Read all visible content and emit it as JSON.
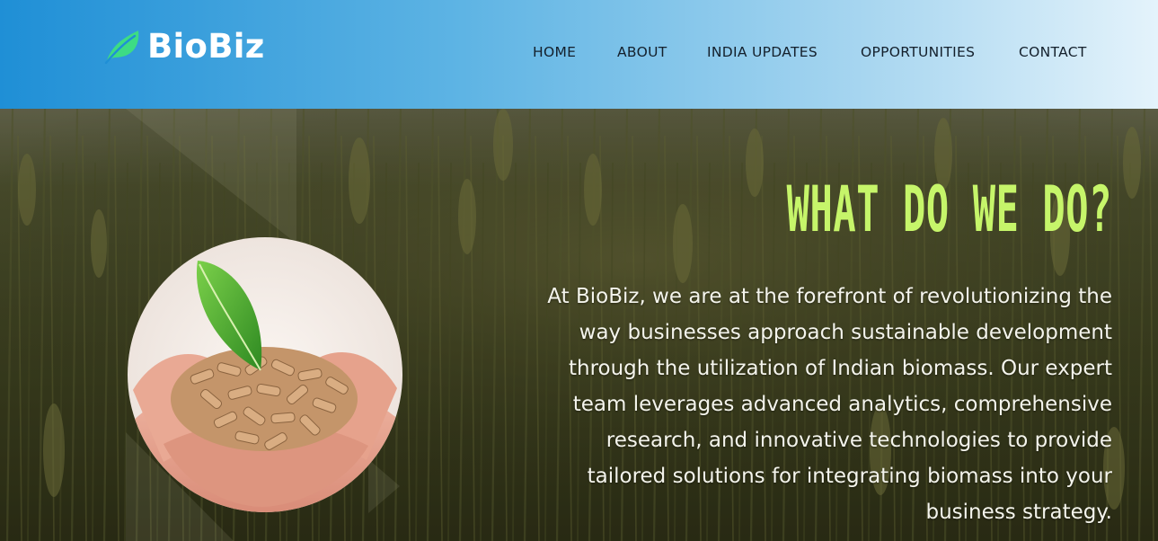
{
  "header": {
    "logo_text": "BioBiz",
    "logo_icon": "leaf-icon",
    "nav": {
      "home": "HOME",
      "about": "ABOUT",
      "india_updates": "INDIA UPDATES",
      "opportunities": "OPPORTUNITIES",
      "contact": "CONTACT"
    }
  },
  "hero": {
    "title": "WHAT DO WE DO?",
    "body": "At BioBiz, we are at the forefront of revolutionizing the way businesses approach sustainable development through the utilization of Indian biomass. Our expert team leverages advanced analytics, comprehensive research, and innovative technologies to provide tailored solutions for integrating biomass into your business strategy.",
    "image_subject": "hands-holding-biomass-pellets-with-leaf"
  },
  "colors": {
    "header_gradient_start": "#1f8fd6",
    "header_gradient_end": "#e4f3fb",
    "logo_leaf": "#3ddc84",
    "title_accent": "#c6f56a",
    "nav_text": "#14202c",
    "body_text": "#f4f4ec"
  }
}
